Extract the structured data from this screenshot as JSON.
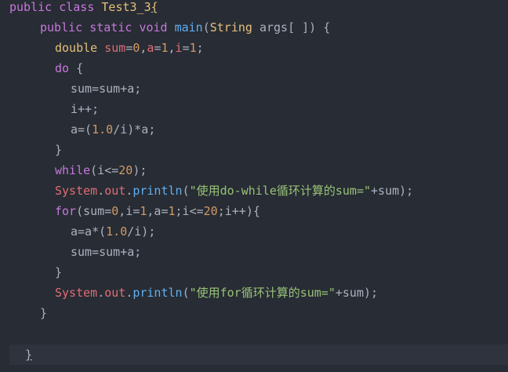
{
  "code": {
    "lines": [
      [
        {
          "t": "public class ",
          "c": "kw"
        },
        {
          "t": "Test3_3",
          "c": "cls"
        },
        {
          "t": "{",
          "c": "cls"
        }
      ],
      [
        {
          "t": "public static ",
          "c": "kw"
        },
        {
          "t": "void ",
          "c": "kw"
        },
        {
          "t": "main",
          "c": "fn"
        },
        {
          "t": "(",
          "c": "plain"
        },
        {
          "t": "String ",
          "c": "cls"
        },
        {
          "t": "args[ ]) {",
          "c": "plain"
        }
      ],
      [
        {
          "t": "double ",
          "c": "cls"
        },
        {
          "t": "sum",
          "c": "var"
        },
        {
          "t": "=",
          "c": "plain"
        },
        {
          "t": "0",
          "c": "num"
        },
        {
          "t": ",",
          "c": "plain"
        },
        {
          "t": "a",
          "c": "var"
        },
        {
          "t": "=",
          "c": "plain"
        },
        {
          "t": "1",
          "c": "num"
        },
        {
          "t": ",",
          "c": "plain"
        },
        {
          "t": "i",
          "c": "var"
        },
        {
          "t": "=",
          "c": "plain"
        },
        {
          "t": "1",
          "c": "num"
        },
        {
          "t": ";",
          "c": "plain"
        }
      ],
      [
        {
          "t": "do ",
          "c": "kw"
        },
        {
          "t": "{",
          "c": "plain"
        }
      ],
      [
        {
          "t": "sum=sum+a;",
          "c": "plain"
        }
      ],
      [
        {
          "t": "i++;",
          "c": "plain"
        }
      ],
      [
        {
          "t": "a=(",
          "c": "plain"
        },
        {
          "t": "1.0",
          "c": "num"
        },
        {
          "t": "/i)*a;",
          "c": "plain"
        }
      ],
      [
        {
          "t": "}",
          "c": "plain"
        }
      ],
      [
        {
          "t": "while",
          "c": "kw"
        },
        {
          "t": "(i<=",
          "c": "plain"
        },
        {
          "t": "20",
          "c": "num"
        },
        {
          "t": ");",
          "c": "plain"
        }
      ],
      [
        {
          "t": "System",
          "c": "var"
        },
        {
          "t": ".",
          "c": "plain"
        },
        {
          "t": "out",
          "c": "var"
        },
        {
          "t": ".",
          "c": "plain"
        },
        {
          "t": "println",
          "c": "fn"
        },
        {
          "t": "(",
          "c": "plain"
        },
        {
          "t": "\"使用do-while循环计算的sum=\"",
          "c": "str"
        },
        {
          "t": "+sum);",
          "c": "plain"
        }
      ],
      [
        {
          "t": "for",
          "c": "kw"
        },
        {
          "t": "(sum=",
          "c": "plain"
        },
        {
          "t": "0",
          "c": "num"
        },
        {
          "t": ",i=",
          "c": "plain"
        },
        {
          "t": "1",
          "c": "num"
        },
        {
          "t": ",a=",
          "c": "plain"
        },
        {
          "t": "1",
          "c": "num"
        },
        {
          "t": ";i<=",
          "c": "plain"
        },
        {
          "t": "20",
          "c": "num"
        },
        {
          "t": ";i++){",
          "c": "plain"
        }
      ],
      [
        {
          "t": "a=a*(",
          "c": "plain"
        },
        {
          "t": "1.0",
          "c": "num"
        },
        {
          "t": "/i);",
          "c": "plain"
        }
      ],
      [
        {
          "t": "sum=sum+a;",
          "c": "plain"
        }
      ],
      [
        {
          "t": "}",
          "c": "plain"
        }
      ],
      [
        {
          "t": "System",
          "c": "var"
        },
        {
          "t": ".",
          "c": "plain"
        },
        {
          "t": "out",
          "c": "var"
        },
        {
          "t": ".",
          "c": "plain"
        },
        {
          "t": "println",
          "c": "fn"
        },
        {
          "t": "(",
          "c": "plain"
        },
        {
          "t": "\"使用for循环计算的sum=\"",
          "c": "str"
        },
        {
          "t": "+sum);",
          "c": "plain"
        }
      ],
      [
        {
          "t": "}",
          "c": "plain"
        }
      ],
      [],
      [
        {
          "t": "}",
          "c": "plain"
        }
      ]
    ]
  },
  "colors": {
    "background": "#282c34",
    "current_line": "#2f333d",
    "keyword": "#c678dd",
    "function": "#61afef",
    "class": "#e5c07b",
    "number": "#d19a66",
    "variable": "#e06c75",
    "string": "#98c379",
    "plain": "#abb2bf"
  }
}
